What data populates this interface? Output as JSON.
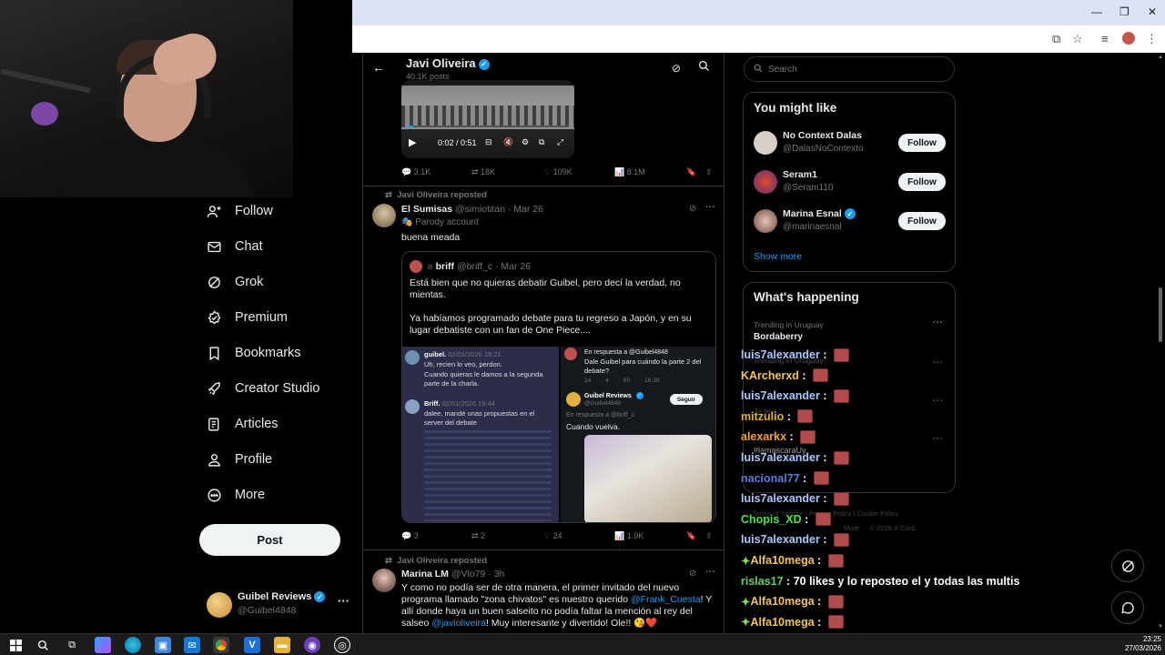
{
  "leftnav": {
    "items": [
      {
        "label": "Follow",
        "icon": "person-add-icon"
      },
      {
        "label": "Chat",
        "icon": "mail-icon"
      },
      {
        "label": "Grok",
        "icon": "grok-icon"
      },
      {
        "label": "Premium",
        "icon": "premium-badge-icon"
      },
      {
        "label": "Bookmarks",
        "icon": "bookmark-icon"
      },
      {
        "label": "Creator Studio",
        "icon": "rocket-icon"
      },
      {
        "label": "Articles",
        "icon": "article-icon"
      },
      {
        "label": "Profile",
        "icon": "person-icon"
      },
      {
        "label": "More",
        "icon": "more-circle-icon"
      }
    ],
    "post_label": "Post",
    "account": {
      "name": "Guibel Reviews",
      "handle": "@Guibel4848"
    }
  },
  "profile_header": {
    "name": "Javi Oliveira",
    "posts": "40.1K posts"
  },
  "video": {
    "time": "0:02 / 0:51"
  },
  "tweet1_stats": {
    "replies": "3.1K",
    "reposts": "18K",
    "likes": "109K",
    "views": "8.1M"
  },
  "tweet2": {
    "repost_label": "Javi Oliveira reposted",
    "name": "El Sumisas",
    "handle": "@simiotitan",
    "date": "· Mar 26",
    "badge": "Parody account",
    "text": "buena meada",
    "quote": {
      "name": "briff",
      "handle": "@briff_c",
      "date": "· Mar 26",
      "text1": "Está bien que no quieras debatir Guibel, pero decí la verdad, no mientas.",
      "text2": "Ya habíamos programado debate para tu regreso a Japón, y en su lugar debatiste con un fan de One Piece....",
      "shot_left": {
        "user1": "guibel.",
        "date1": "02/01/2026 19:21",
        "msg1": "Uh, recien lo veo, perdon.",
        "msg2": "Cuando quieras le damos a la segunda parte de la charla.",
        "user2": "Briff.",
        "date2": "02/01/2026 19:44",
        "msg3": "dalee, mandé unas propuestas en el server del debate"
      },
      "shot_right": {
        "reply_to": "En respuesta a @Guibel4848",
        "msg": "Dale Guibel para cuándo la parte 2 del debate?",
        "stats": [
          "14",
          "4",
          "60",
          "18.2K"
        ],
        "user": "Guibel Reviews",
        "handle": "@Guibel4848",
        "follow": "Seguir",
        "reply_to2": "En respuesta a @briff_c",
        "msg2": "Cuando vuelva."
      }
    },
    "stats": {
      "replies": "3",
      "reposts": "2",
      "likes": "24",
      "views": "1.9K"
    }
  },
  "tweet3": {
    "repost_label": "Javi Oliveira reposted",
    "name": "Marina LM",
    "handle": "@Vlo79",
    "date": "· 3h",
    "text_a": "Y como no podía ser de otra manera, el primer invitado del nuevo programa llamado \"zona chivatos\" es nuestro querido ",
    "mention1": "@Frank_Cuesta",
    "text_b": "! Y allí donde haya un buen salseito no podía faltar la mención al rey del salseo ",
    "mention2": "@javioliveira",
    "text_c": "! Muy interesante y divertido! Ole!! 😘❤️"
  },
  "search": {
    "placeholder": "Search"
  },
  "you_might_like": {
    "title": "You might like",
    "people": [
      {
        "name": "No Context Dalas",
        "handle": "@DalasNoContexto",
        "verified": false
      },
      {
        "name": "Seram1",
        "handle": "@Seram110",
        "verified": false
      },
      {
        "name": "Marina Esnal",
        "handle": "@marinaesnal",
        "verified": true
      }
    ],
    "follow_label": "Follow",
    "show_more": "Show more"
  },
  "whats_happening": {
    "title": "What's happening",
    "trending_label": "Trending in Uruguay",
    "topic1": "Bordaberry",
    "ghost1": "Trending in Uruguay",
    "ghost2": "Ja teja",
    "ghost3": "#lamascaraUy"
  },
  "footer_links": {
    "terms": "Terms of Service",
    "privacy": "Privacy Policy",
    "cookie": "Cookie Policy",
    "more": "More ···",
    "copyright": "© 2026 X Corp."
  },
  "chat": [
    {
      "user": "luis7alexander",
      "color": "#a9c8ff",
      "msg": "",
      "emote": true,
      "diamond": false
    },
    {
      "user": "KArcherxd",
      "color": "#f2c35b",
      "msg": "",
      "emote": true,
      "diamond": false
    },
    {
      "user": "luis7alexander",
      "color": "#a9c8ff",
      "msg": "",
      "emote": true,
      "diamond": false
    },
    {
      "user": "mitzulio",
      "color": "#e0b12c",
      "msg": "",
      "emote": true,
      "diamond": false
    },
    {
      "user": "alexarkx",
      "color": "#ff9a2b",
      "msg": "",
      "emote": true,
      "diamond": false
    },
    {
      "user": "luis7alexander",
      "color": "#a9c8ff",
      "msg": "",
      "emote": true,
      "diamond": false
    },
    {
      "user": "nacional77",
      "color": "#5b7bd6",
      "msg": "",
      "emote": true,
      "diamond": false
    },
    {
      "user": "luis7alexander",
      "color": "#a9c8ff",
      "msg": "",
      "emote": true,
      "diamond": false
    },
    {
      "user": "Chopis_XD",
      "color": "#4de04d",
      "msg": "",
      "emote": true,
      "diamond": false
    },
    {
      "user": "luis7alexander",
      "color": "#a9c8ff",
      "msg": "",
      "emote": true,
      "diamond": false
    },
    {
      "user": "Alfa10mega",
      "color": "#f2c35b",
      "msg": "",
      "emote": true,
      "diamond": true
    },
    {
      "user": "rislas17",
      "color": "#5fd35f",
      "msg": "70 likes y lo reposteo el y todas las multis",
      "emote": false,
      "diamond": false
    },
    {
      "user": "Alfa10mega",
      "color": "#f2c35b",
      "msg": "",
      "emote": true,
      "diamond": true
    },
    {
      "user": "Alfa10mega",
      "color": "#f2c35b",
      "msg": "",
      "emote": true,
      "diamond": true
    }
  ],
  "taskbar": {
    "time": "23:25",
    "date": "27/03/2026"
  },
  "colors": {
    "accent": "#1d9bf0",
    "muted": "#71767b",
    "border": "#2f3336"
  }
}
